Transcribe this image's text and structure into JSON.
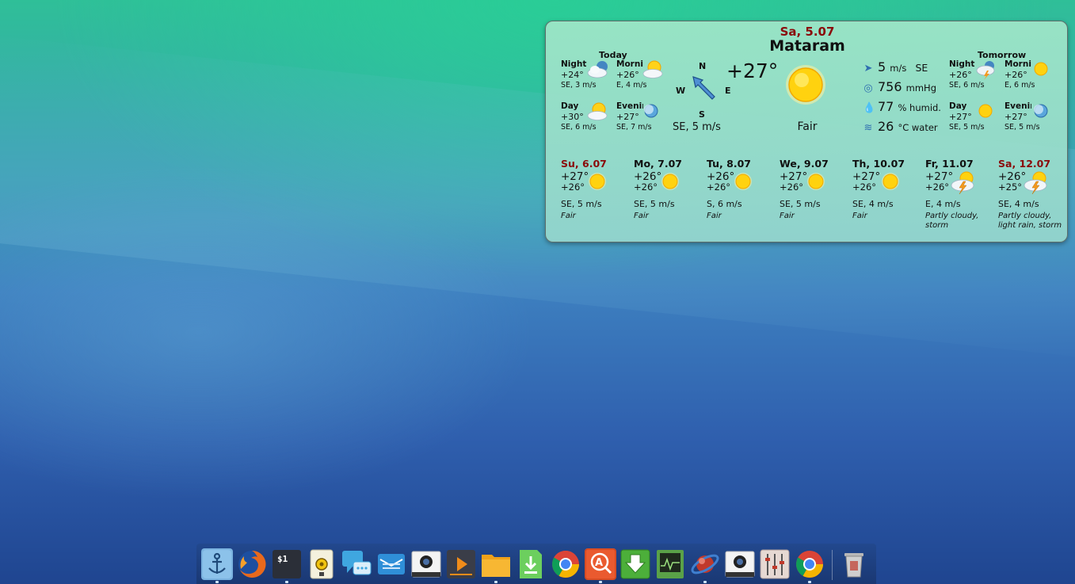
{
  "widget": {
    "date": "Sa, 5.07",
    "city": "Mataram",
    "today_label": "Today",
    "tomorrow_label": "Tomorrow",
    "today": {
      "night": {
        "name": "Night",
        "temp": "+24°",
        "wind": "SE, 3 m/s",
        "icon": "night-cloudy-icon"
      },
      "morning": {
        "name": "Morning",
        "temp": "+26°",
        "wind": "E, 4 m/s",
        "icon": "partly-cloudy-icon"
      },
      "day": {
        "name": "Day",
        "temp": "+30°",
        "wind": "SE, 6 m/s",
        "icon": "partly-cloudy-icon"
      },
      "evening": {
        "name": "Evening",
        "temp": "+27°",
        "wind": "SE, 7 m/s",
        "icon": "moon-icon"
      }
    },
    "tomorrow": {
      "night": {
        "name": "Night",
        "temp": "+26°",
        "wind": "SE, 6 m/s",
        "icon": "night-storm-icon"
      },
      "morning": {
        "name": "Morning",
        "temp": "+26°",
        "wind": "E, 6 m/s",
        "icon": "sun-icon"
      },
      "day": {
        "name": "Day",
        "temp": "+27°",
        "wind": "SE, 5 m/s",
        "icon": "sun-icon"
      },
      "evening": {
        "name": "Evening",
        "temp": "+27°",
        "wind": "SE, 5 m/s",
        "icon": "moon-icon"
      }
    },
    "compass": {
      "n": "N",
      "e": "E",
      "w": "W",
      "s": "S"
    },
    "wind_summary": "SE, 5 m/s",
    "current_temp": "+27°",
    "condition": "Fair",
    "stats": {
      "wind_speed": "5",
      "wind_unit": "m/s",
      "wind_dir": "SE",
      "pressure": "756",
      "pressure_unit": "mmHg",
      "humidity": "77",
      "humidity_unit": "% humid.",
      "water": "26",
      "water_unit": "°C water"
    },
    "forecast": [
      {
        "day": "Su, 6.07",
        "weekend": true,
        "high": "+27°",
        "low": "+26°",
        "wind": "SE, 5 m/s",
        "cond": "Fair",
        "icon": "sun-icon"
      },
      {
        "day": "Mo, 7.07",
        "weekend": false,
        "high": "+26°",
        "low": "+26°",
        "wind": "SE, 5 m/s",
        "cond": "Fair",
        "icon": "sun-icon"
      },
      {
        "day": "Tu, 8.07",
        "weekend": false,
        "high": "+26°",
        "low": "+26°",
        "wind": "S, 6 m/s",
        "cond": "Fair",
        "icon": "sun-icon"
      },
      {
        "day": "We, 9.07",
        "weekend": false,
        "high": "+27°",
        "low": "+26°",
        "wind": "SE, 5 m/s",
        "cond": "Fair",
        "icon": "sun-icon"
      },
      {
        "day": "Th, 10.07",
        "weekend": false,
        "high": "+27°",
        "low": "+26°",
        "wind": "SE, 4 m/s",
        "cond": "Fair",
        "icon": "sun-icon"
      },
      {
        "day": "Fr, 11.07",
        "weekend": false,
        "high": "+27°",
        "low": "+26°",
        "wind": "E, 4 m/s",
        "cond": "Partly cloudy, storm",
        "icon": "storm-sun-icon"
      },
      {
        "day": "Sa, 12.07",
        "weekend": true,
        "high": "+26°",
        "low": "+25°",
        "wind": "SE, 4 m/s",
        "cond": "Partly cloudy, light rain, storm",
        "icon": "storm-sun-icon"
      }
    ]
  },
  "dock": {
    "items": [
      {
        "name": "anchor-icon",
        "running": true
      },
      {
        "name": "firefox-icon",
        "running": false
      },
      {
        "name": "terminal-icon",
        "running": true
      },
      {
        "name": "media-player-icon",
        "running": false
      },
      {
        "name": "chat-icon",
        "running": false
      },
      {
        "name": "mail-icon",
        "running": false
      },
      {
        "name": "screenshot-icon",
        "running": false
      },
      {
        "name": "media-center-icon",
        "running": false
      },
      {
        "name": "files-icon",
        "running": true
      },
      {
        "name": "installer-icon",
        "running": false
      },
      {
        "name": "chrome-icon",
        "running": false
      },
      {
        "name": "font-viewer-icon",
        "running": true
      },
      {
        "name": "download-icon",
        "running": false
      },
      {
        "name": "system-monitor-icon",
        "running": false
      },
      {
        "name": "browser-orbit-icon",
        "running": true
      },
      {
        "name": "camera-icon",
        "running": false
      },
      {
        "name": "mixer-icon",
        "running": false
      },
      {
        "name": "chrome-icon",
        "running": true
      },
      {
        "name": "trash-icon",
        "running": false
      }
    ]
  }
}
